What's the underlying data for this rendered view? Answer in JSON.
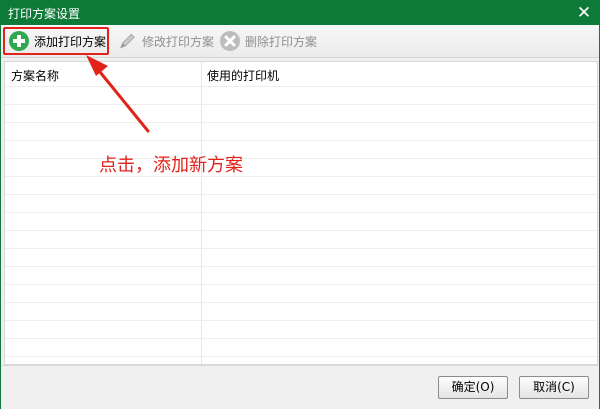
{
  "window": {
    "title": "打印方案设置",
    "close_glyph": "✕"
  },
  "toolbar": {
    "add_label": "添加打印方案",
    "edit_label": "修改打印方案",
    "delete_label": "删除打印方案",
    "icons": {
      "add": "plus-circle-icon",
      "edit": "pencil-icon",
      "delete": "x-circle-icon"
    }
  },
  "grid": {
    "columns": [
      "方案名称",
      "使用的打印机"
    ],
    "rows": []
  },
  "annotation": {
    "text": "点击，添加新方案",
    "color": "#e2231a"
  },
  "footer": {
    "ok_label": "确定(O)",
    "cancel_label": "取消(C)"
  },
  "colors": {
    "titlebar": "#0e7a38",
    "add_icon": "#2fa84f",
    "annotation": "#e2231a"
  }
}
